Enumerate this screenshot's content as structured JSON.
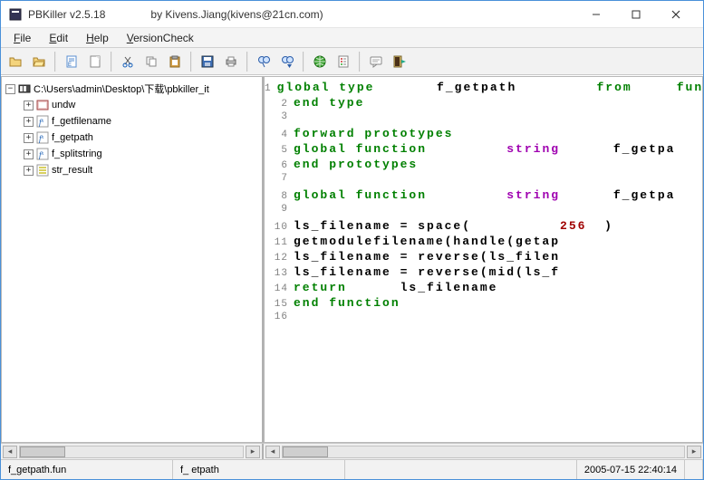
{
  "title": "PBKiller v2.5.18",
  "author": "by Kivens.Jiang(kivens@21cn.com)",
  "menu": {
    "file": "File",
    "file_u": "F",
    "edit": "Edit",
    "edit_u": "E",
    "help": "Help",
    "help_u": "H",
    "version": "VersionCheck",
    "version_u": "V"
  },
  "toolbar_icons": [
    "open-icon",
    "open-alt-icon",
    "sep",
    "document-icon",
    "new-icon",
    "sep",
    "cut-icon",
    "copy-icon",
    "paste-icon",
    "sep",
    "save-icon",
    "print-icon",
    "sep",
    "find-icon",
    "find-next-icon",
    "sep",
    "web-icon",
    "options-icon",
    "sep",
    "comment-icon",
    "exit-icon"
  ],
  "tree": {
    "root": {
      "label": "C:\\Users\\admin\\Desktop\\下载\\pbkiller_it",
      "expanded": true
    },
    "children": [
      {
        "icon": "undw",
        "label": "undw"
      },
      {
        "icon": "func",
        "label": "f_getfilename"
      },
      {
        "icon": "func",
        "label": "f_getpath"
      },
      {
        "icon": "func",
        "label": "f_splitstring"
      },
      {
        "icon": "struct",
        "label": "str_result"
      }
    ]
  },
  "code": [
    {
      "n": 1,
      "tokens": [
        [
          "kw",
          "global type"
        ],
        [
          "sp",
          7
        ],
        [
          "id",
          "f_getpath"
        ],
        [
          "sp",
          9
        ],
        [
          "kw",
          "from"
        ],
        [
          "sp",
          5
        ],
        [
          "kw",
          "fun"
        ]
      ]
    },
    {
      "n": 2,
      "tokens": [
        [
          "kw",
          "end type"
        ]
      ]
    },
    {
      "n": 3,
      "tokens": []
    },
    {
      "n": 4,
      "tokens": [
        [
          "kw",
          "forward prototypes"
        ]
      ]
    },
    {
      "n": 5,
      "tokens": [
        [
          "kw",
          "global function"
        ],
        [
          "sp",
          9
        ],
        [
          "ty",
          "string"
        ],
        [
          "sp",
          6
        ],
        [
          "id",
          "f_getpa"
        ]
      ]
    },
    {
      "n": 6,
      "tokens": [
        [
          "kw",
          "end prototypes"
        ]
      ]
    },
    {
      "n": 7,
      "tokens": []
    },
    {
      "n": 8,
      "tokens": [
        [
          "kw",
          "global function"
        ],
        [
          "sp",
          9
        ],
        [
          "ty",
          "string"
        ],
        [
          "sp",
          6
        ],
        [
          "id",
          "f_getpa"
        ]
      ]
    },
    {
      "n": 9,
      "tokens": []
    },
    {
      "n": 10,
      "tokens": [
        [
          "id",
          "ls_filename = space("
        ],
        [
          "sp",
          10
        ],
        [
          "num",
          "256"
        ],
        [
          "sp",
          2
        ],
        [
          "id",
          ")"
        ]
      ]
    },
    {
      "n": 11,
      "tokens": [
        [
          "id",
          "getmodulefilename(handle(getap"
        ]
      ]
    },
    {
      "n": 12,
      "tokens": [
        [
          "id",
          "ls_filename = reverse(ls_filen"
        ]
      ]
    },
    {
      "n": 13,
      "tokens": [
        [
          "id",
          "ls_filename = reverse(mid(ls_f"
        ]
      ]
    },
    {
      "n": 14,
      "tokens": [
        [
          "kw",
          "return"
        ],
        [
          "sp",
          6
        ],
        [
          "id",
          "ls_filename"
        ]
      ]
    },
    {
      "n": 15,
      "tokens": [
        [
          "kw",
          "end function"
        ]
      ]
    },
    {
      "n": 16,
      "tokens": []
    }
  ],
  "status": {
    "left": "f_getpath.fun",
    "mid": "f_   etpath",
    "date": "2005-07-15 22:40:14"
  }
}
